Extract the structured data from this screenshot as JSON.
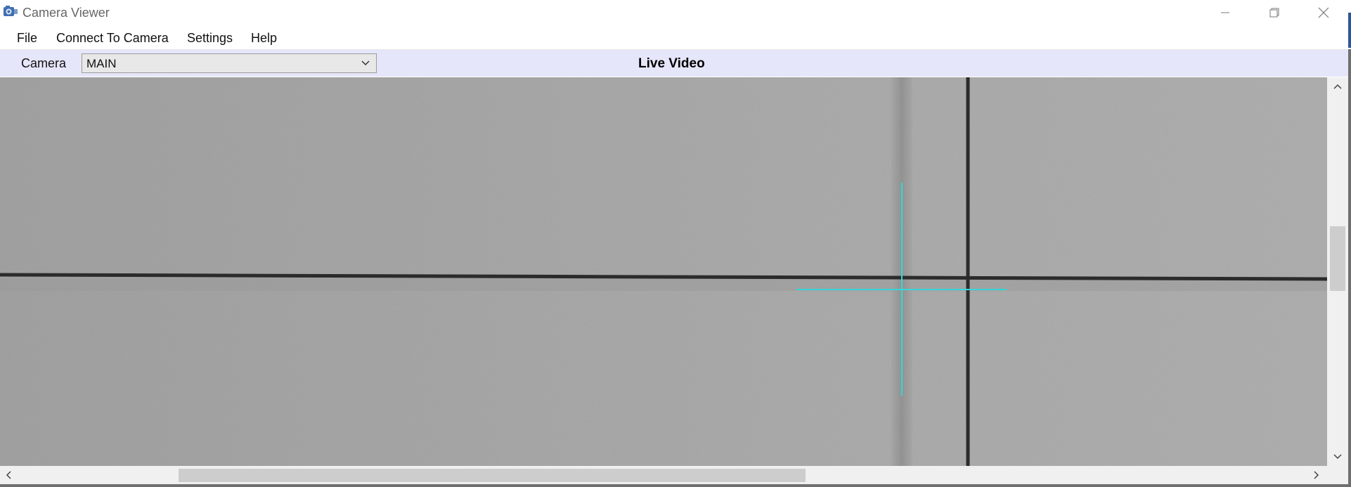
{
  "window": {
    "title": "Camera Viewer",
    "buttons": {
      "minimize_icon": "minimize-icon",
      "maximize_icon": "restore-icon",
      "close_icon": "close-icon"
    }
  },
  "menu": {
    "items": [
      {
        "label": "File"
      },
      {
        "label": "Connect To Camera"
      },
      {
        "label": "Settings"
      },
      {
        "label": "Help"
      }
    ]
  },
  "toolbar": {
    "camera_label": "Camera",
    "camera_select": {
      "value": "MAIN"
    },
    "view_title": "Live Video"
  },
  "video": {
    "crosshair_color": "#35d6d6",
    "line_color": "#2b2b2b"
  },
  "colors": {
    "toolbar_bg": "#e6e6fa"
  }
}
